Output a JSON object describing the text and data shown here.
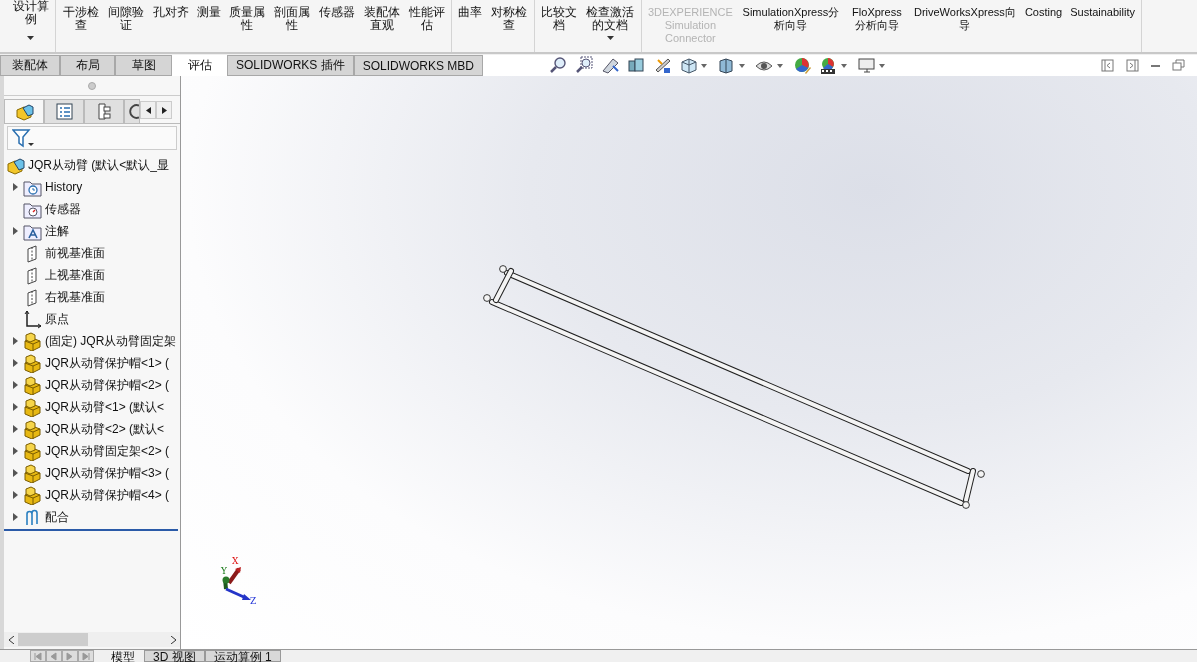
{
  "ribbon": {
    "groups": [
      {
        "items": [
          {
            "label": "设计算例",
            "dropdown": true,
            "disabled": false
          }
        ]
      },
      {
        "items": [
          {
            "label": "干涉检查",
            "dropdown": false,
            "disabled": false
          },
          {
            "label": "间隙验证",
            "dropdown": false,
            "disabled": false
          },
          {
            "label": "孔对齐",
            "dropdown": false,
            "disabled": false
          },
          {
            "label": "测量",
            "dropdown": false,
            "disabled": false
          },
          {
            "label": "质量属性",
            "dropdown": false,
            "disabled": false
          },
          {
            "label": "剖面属性",
            "dropdown": false,
            "disabled": false
          },
          {
            "label": "传感器",
            "dropdown": false,
            "disabled": false
          },
          {
            "label": "装配体直观",
            "dropdown": false,
            "disabled": false
          },
          {
            "label": "性能评估",
            "dropdown": false,
            "disabled": false
          }
        ]
      },
      {
        "items": [
          {
            "label": "曲率",
            "dropdown": false,
            "disabled": false
          },
          {
            "label": "对称检查",
            "dropdown": false,
            "disabled": false
          }
        ]
      },
      {
        "items": [
          {
            "label": "比较文档",
            "dropdown": false,
            "disabled": false
          },
          {
            "label": "检查激活的文档",
            "dropdown": true,
            "disabled": false
          }
        ]
      },
      {
        "items": [
          {
            "label": "3DEXPERIENCE Simulation Connector",
            "dropdown": false,
            "disabled": true
          },
          {
            "label": "SimulationXpress分析向导",
            "dropdown": false,
            "disabled": false
          },
          {
            "label": "FloXpress分析向导",
            "dropdown": false,
            "disabled": false
          },
          {
            "label": "DriveWorksXpress向导",
            "dropdown": false,
            "disabled": false
          },
          {
            "label": "Costing",
            "dropdown": false,
            "disabled": false
          },
          {
            "label": "Sustainability",
            "dropdown": false,
            "disabled": false
          }
        ]
      }
    ]
  },
  "tabs": [
    {
      "label": "装配体",
      "selected": false
    },
    {
      "label": "布局",
      "selected": false
    },
    {
      "label": "草图",
      "selected": false
    },
    {
      "label": "评估",
      "selected": true
    },
    {
      "label": "SOLIDWORKS 插件",
      "selected": false
    },
    {
      "label": "SOLIDWORKS MBD",
      "selected": false
    }
  ],
  "panel_tabs": [
    {
      "selected": true
    },
    {
      "selected": false
    },
    {
      "selected": false
    },
    {
      "selected": false
    }
  ],
  "feature_tree": {
    "root": {
      "label": "JQR从动臂  (默认<默认_显",
      "children": [
        {
          "kind": "history",
          "label": "History",
          "expandable": true
        },
        {
          "kind": "sensor",
          "label": "传感器",
          "expandable": false
        },
        {
          "kind": "annotation",
          "label": "注解",
          "expandable": true
        },
        {
          "kind": "plane",
          "label": "前视基准面",
          "expandable": false
        },
        {
          "kind": "plane",
          "label": "上视基准面",
          "expandable": false
        },
        {
          "kind": "plane",
          "label": "右视基准面",
          "expandable": false
        },
        {
          "kind": "origin",
          "label": "原点",
          "expandable": false
        },
        {
          "kind": "part",
          "label": "(固定) JQR从动臂固定架",
          "expandable": true
        },
        {
          "kind": "part",
          "label": "JQR从动臂保护帽<1> (",
          "expandable": true
        },
        {
          "kind": "part",
          "label": "JQR从动臂保护帽<2> (",
          "expandable": true
        },
        {
          "kind": "part",
          "label": "JQR从动臂<1> (默认<",
          "expandable": true
        },
        {
          "kind": "part",
          "label": "JQR从动臂<2> (默认<",
          "expandable": true
        },
        {
          "kind": "part",
          "label": "JQR从动臂固定架<2> (",
          "expandable": true
        },
        {
          "kind": "part",
          "label": "JQR从动臂保护帽<3> (",
          "expandable": true
        },
        {
          "kind": "part",
          "label": "JQR从动臂保护帽<4> (",
          "expandable": true
        },
        {
          "kind": "mates",
          "label": "配合",
          "expandable": true
        }
      ]
    }
  },
  "triad": {
    "x": "X",
    "y": "Y",
    "z": "Z"
  },
  "bottom_tabs": [
    {
      "label": "模型",
      "selected": true
    },
    {
      "label": "3D 视图",
      "selected": false
    },
    {
      "label": "运动算例 1",
      "selected": false
    }
  ]
}
